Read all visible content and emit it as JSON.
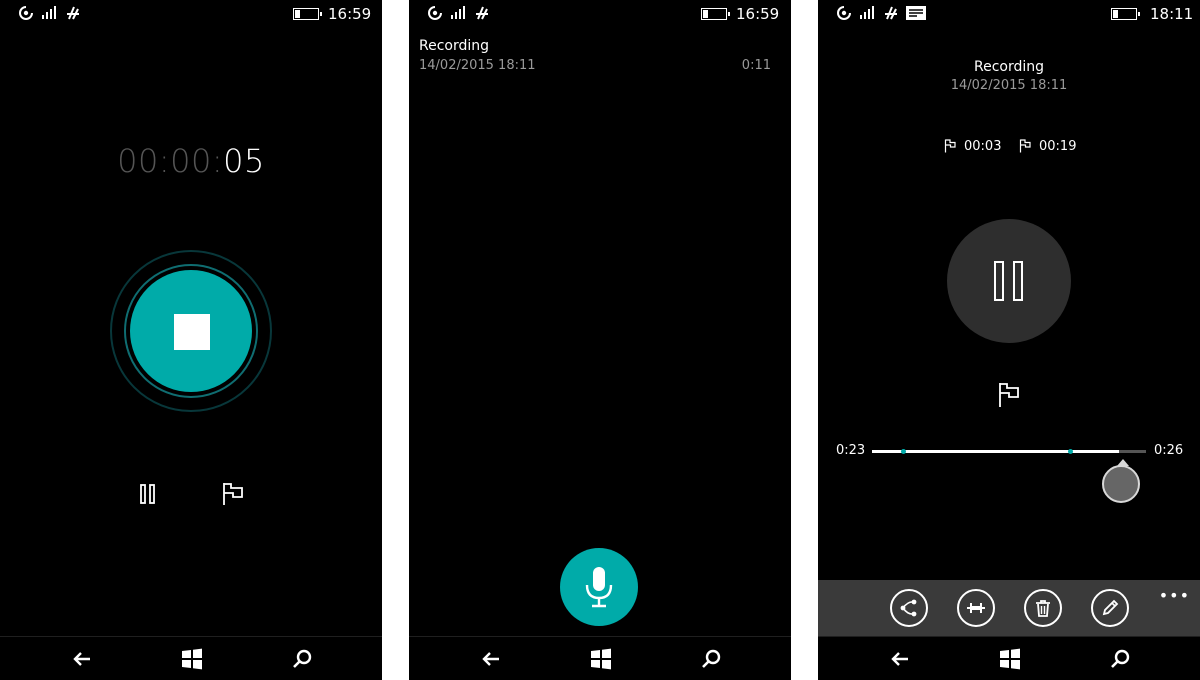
{
  "screens": [
    {
      "clock": "16:59",
      "timer": {
        "dim": "00:00:",
        "bright": "05"
      }
    },
    {
      "clock": "16:59",
      "recording": {
        "title": "Recording",
        "date": "14/02/2015 18:11",
        "duration": "0:11"
      }
    },
    {
      "clock": "18:11",
      "recording": {
        "title": "Recording",
        "date": "14/02/2015 18:11"
      },
      "markers": [
        "00:03",
        "00:19"
      ],
      "playback": {
        "current": "0:23",
        "total": "0:26",
        "progress_fraction": 0.9
      },
      "appbar": {
        "more": "•••"
      }
    }
  ],
  "colors": {
    "accent": "#00aba9",
    "background": "#000000",
    "appbar": "#3a3a3a"
  },
  "icons": [
    "nfc-icon",
    "wifi-icon",
    "data-icon",
    "message-icon",
    "battery-icon",
    "back-icon",
    "windows-icon",
    "search-icon",
    "stop-icon",
    "pause-icon",
    "flag-icon",
    "microphone-icon",
    "share-icon",
    "trim-icon",
    "delete-icon",
    "edit-icon"
  ]
}
